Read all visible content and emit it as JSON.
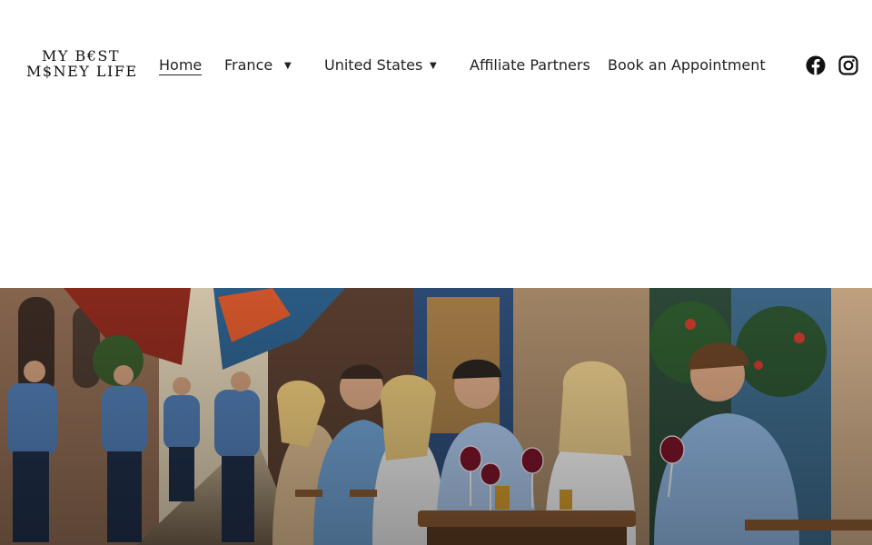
{
  "brand": {
    "logo_line1": "MY B€ST",
    "logo_line2": "M$NEY LIFE"
  },
  "nav": {
    "home": "Home",
    "france": "France",
    "united_states": "United States",
    "affiliate": "Affiliate Partners",
    "book": "Book an Appointment",
    "caret": "▼"
  },
  "social": {
    "facebook_icon": "facebook-icon",
    "instagram_icon": "instagram-icon"
  },
  "hero": {
    "image": "illustration of people drinking red wine at an outdoor street café"
  },
  "colors": {
    "text": "#222222",
    "background": "#ffffff"
  }
}
